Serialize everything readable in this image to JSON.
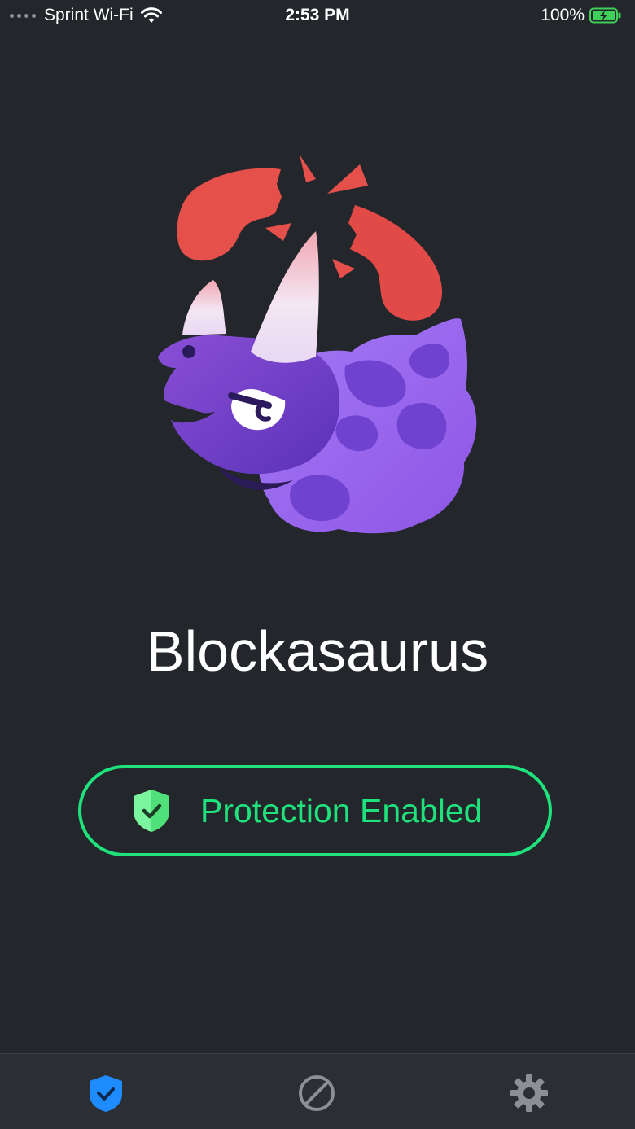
{
  "status_bar": {
    "carrier": "Sprint Wi-Fi",
    "time": "2:53 PM",
    "battery": "100%"
  },
  "app": {
    "title": "Blockasaurus",
    "protection_label": "Protection Enabled"
  },
  "tab_bar": {
    "items": [
      {
        "icon": "shield-check-icon",
        "active": true
      },
      {
        "icon": "block-icon",
        "active": false
      },
      {
        "icon": "gear-icon",
        "active": false
      }
    ]
  },
  "colors": {
    "background": "#23262b",
    "accent_green": "#1fe27d",
    "tab_active": "#1e8bff",
    "tab_inactive": "#8c8f94",
    "phone_red": "#e5504a",
    "dino_purple": "#7c4ad9"
  }
}
